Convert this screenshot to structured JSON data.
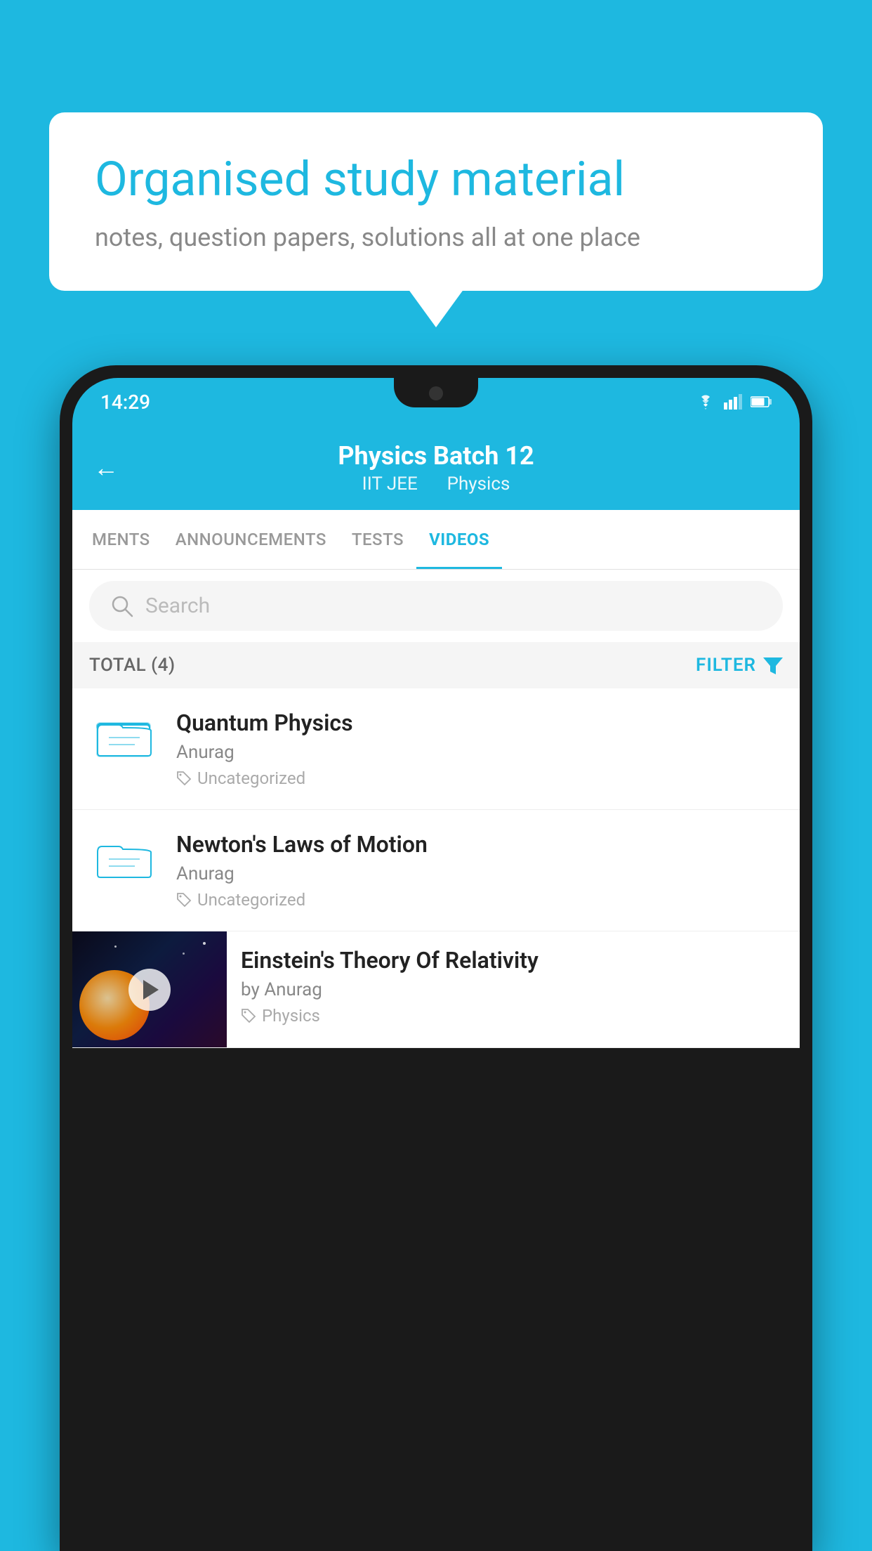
{
  "background_color": "#1eb8e0",
  "speech_bubble": {
    "title": "Organised study material",
    "subtitle": "notes, question papers, solutions all at one place"
  },
  "status_bar": {
    "time": "14:29",
    "icons": [
      "wifi",
      "signal",
      "battery"
    ]
  },
  "app_header": {
    "back_label": "←",
    "title": "Physics Batch 12",
    "subtitle_part1": "IIT JEE",
    "subtitle_part2": "Physics"
  },
  "tabs": [
    {
      "label": "MENTS",
      "active": false
    },
    {
      "label": "ANNOUNCEMENTS",
      "active": false
    },
    {
      "label": "TESTS",
      "active": false
    },
    {
      "label": "VIDEOS",
      "active": true
    }
  ],
  "search": {
    "placeholder": "Search"
  },
  "filter_row": {
    "total_label": "TOTAL (4)",
    "filter_label": "FILTER"
  },
  "videos": [
    {
      "id": 1,
      "title": "Quantum Physics",
      "author": "Anurag",
      "tag": "Uncategorized",
      "type": "folder",
      "has_thumbnail": false
    },
    {
      "id": 2,
      "title": "Newton's Laws of Motion",
      "author": "Anurag",
      "tag": "Uncategorized",
      "type": "folder",
      "has_thumbnail": false
    },
    {
      "id": 3,
      "title": "Einstein's Theory Of Relativity",
      "author": "by Anurag",
      "tag": "Physics",
      "type": "video",
      "has_thumbnail": true
    }
  ]
}
